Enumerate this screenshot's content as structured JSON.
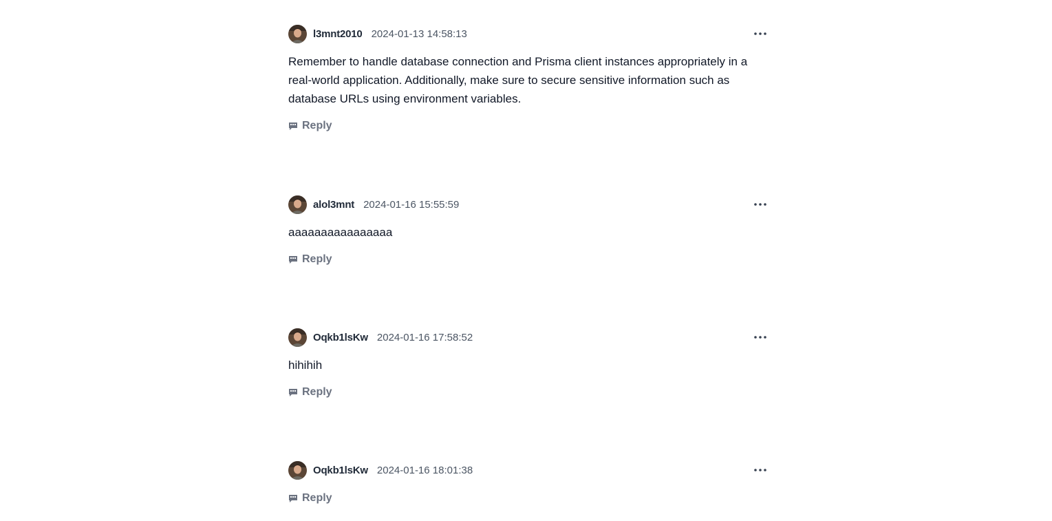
{
  "comments": [
    {
      "username": "l3mnt2010",
      "timestamp": "2024-01-13 14:58:13",
      "body": "Remember to handle database connection and Prisma client instances appropriately in a real-world application. Additionally, make sure to secure sensitive information such as database URLs using environment variables.",
      "reply_label": "Reply"
    },
    {
      "username": "alol3mnt",
      "timestamp": "2024-01-16 15:55:59",
      "body": "aaaaaaaaaaaaaaaa",
      "reply_label": "Reply"
    },
    {
      "username": "Oqkb1lsKw",
      "timestamp": "2024-01-16 17:58:52",
      "body": "hihihih",
      "reply_label": "Reply"
    },
    {
      "username": "Oqkb1lsKw",
      "timestamp": "2024-01-16 18:01:38",
      "body": "",
      "reply_label": "Reply"
    }
  ],
  "icons": {
    "more": "more-horizontal-icon",
    "reply": "chat-bubble-icon"
  }
}
